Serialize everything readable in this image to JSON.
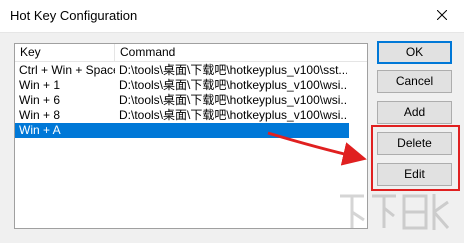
{
  "window": {
    "title": "Hot Key Configuration",
    "close_icon": "close-icon"
  },
  "list": {
    "columns": [
      "Key",
      "Command"
    ],
    "rows": [
      {
        "key": "Ctrl + Win + Space",
        "command": "D:\\tools\\桌面\\下载吧\\hotkeyplus_v100\\sst..."
      },
      {
        "key": "Win + 1",
        "command": "D:\\tools\\桌面\\下载吧\\hotkeyplus_v100\\wsi..."
      },
      {
        "key": "Win + 6",
        "command": "D:\\tools\\桌面\\下载吧\\hotkeyplus_v100\\wsi..."
      },
      {
        "key": "Win + 8",
        "command": "D:\\tools\\桌面\\下载吧\\hotkeyplus_v100\\wsi..."
      },
      {
        "key": "Win + A",
        "command": ""
      }
    ],
    "selected_index": 4,
    "selection_color": "#0078d7"
  },
  "buttons": {
    "ok": "OK",
    "cancel": "Cancel",
    "add": "Add",
    "delete": "Delete",
    "edit": "Edit"
  },
  "annotation": {
    "highlight_color": "#e02020"
  }
}
